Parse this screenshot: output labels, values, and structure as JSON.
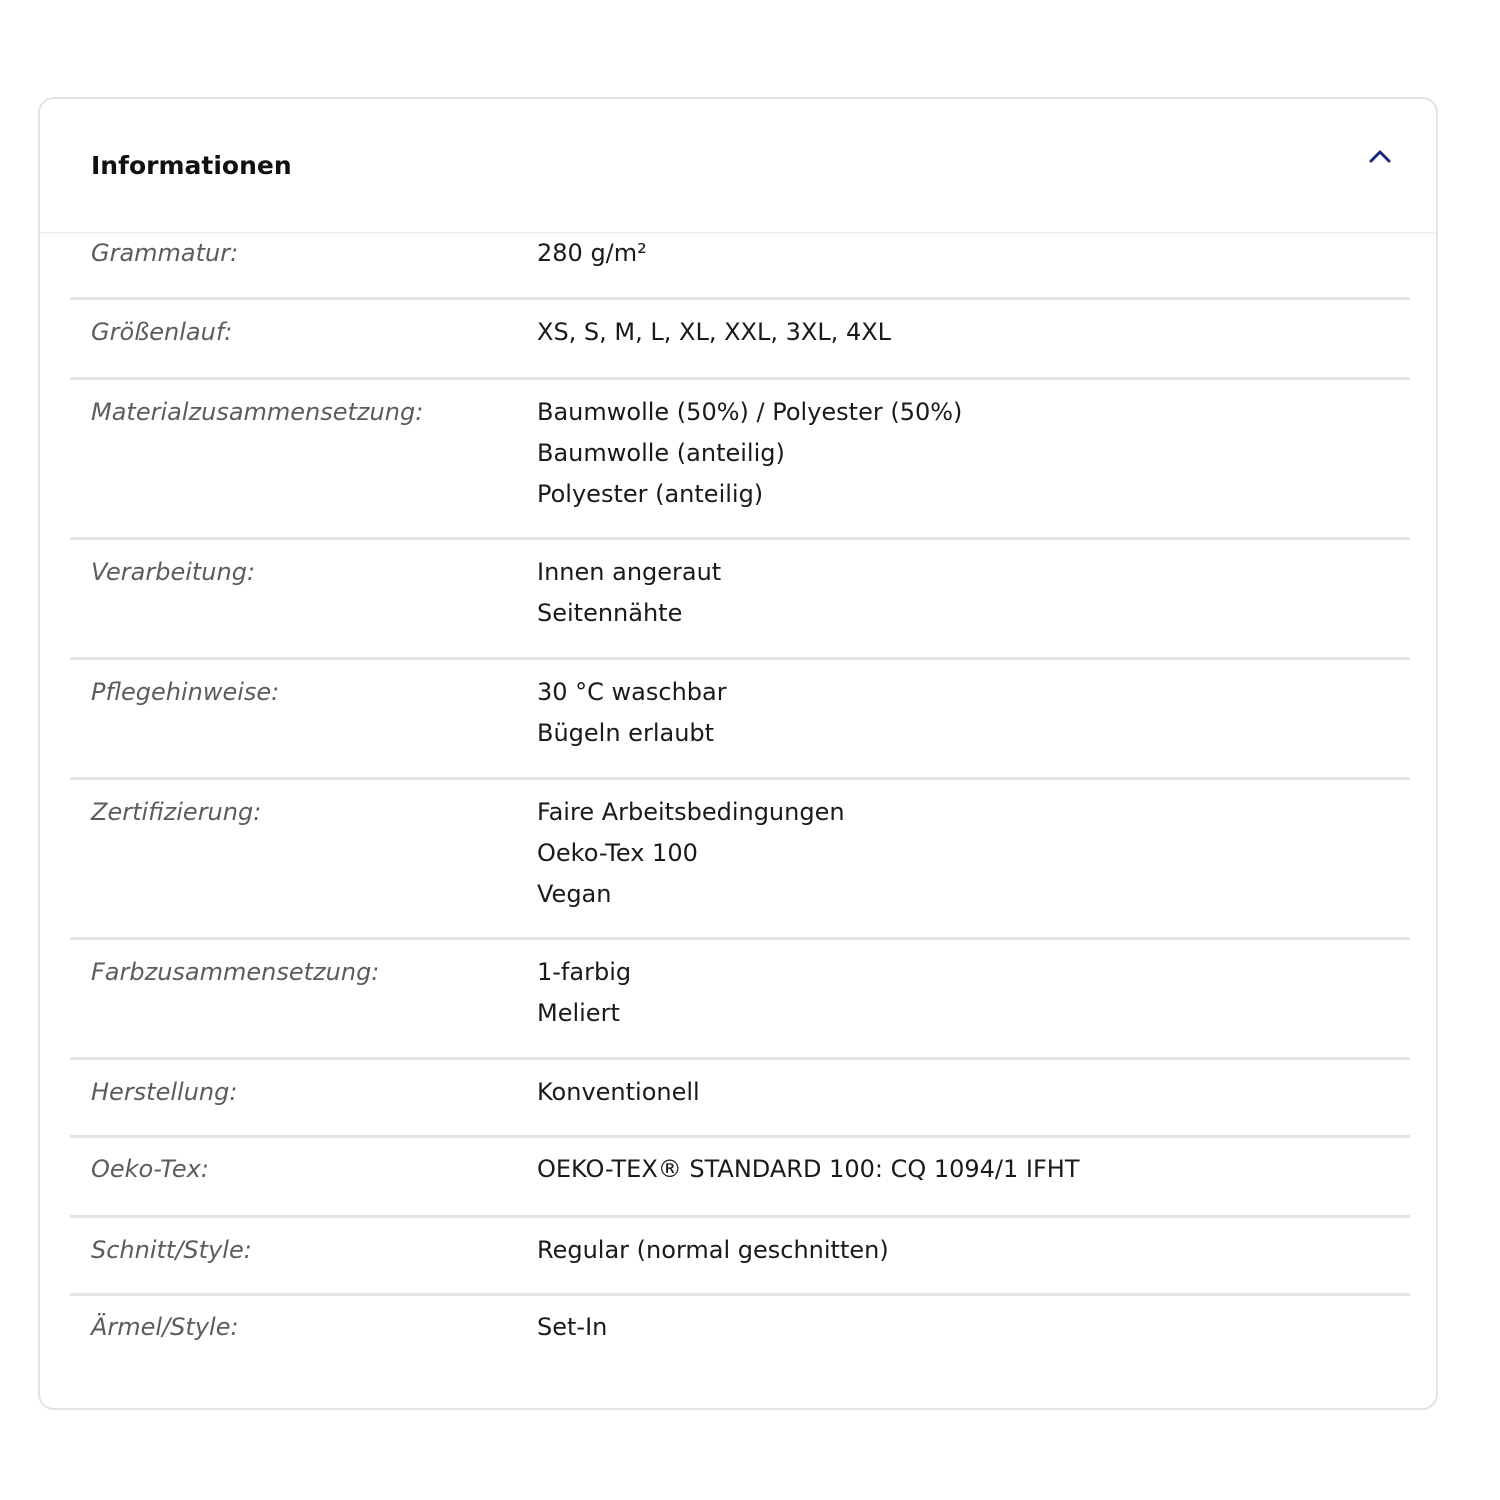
{
  "accordion": {
    "title": "Informationen",
    "toggle_icon": "chevron-up-icon",
    "accent_color": "#1a2a7a",
    "expanded": true
  },
  "rows": [
    {
      "label": "Grammatur:",
      "values": [
        "280 g/m²"
      ]
    },
    {
      "label": "Größenlauf:",
      "values": [
        "XS, S, M, L, XL, XXL, 3XL, 4XL"
      ]
    },
    {
      "label": "Materialzusammensetzung:",
      "values": [
        "Baumwolle (50%) / Polyester (50%)",
        "Baumwolle (anteilig)",
        "Polyester (anteilig)"
      ]
    },
    {
      "label": "Verarbeitung:",
      "values": [
        "Innen angeraut",
        "Seitennähte"
      ]
    },
    {
      "label": "Pflegehinweise:",
      "values": [
        "30 °C waschbar",
        "Bügeln erlaubt"
      ]
    },
    {
      "label": "Zertifizierung:",
      "values": [
        "Faire Arbeitsbedingungen",
        "Oeko-Tex 100",
        "Vegan"
      ]
    },
    {
      "label": "Farbzusammensetzung:",
      "values": [
        "1-farbig",
        "Meliert"
      ]
    },
    {
      "label": "Herstellung:",
      "values": [
        "Konventionell"
      ]
    },
    {
      "label": "Oeko-Tex:",
      "values": [
        "OEKO-TEX® STANDARD 100: CQ 1094/1 IFHT"
      ]
    },
    {
      "label": "Schnitt/Style:",
      "values": [
        "Regular (normal geschnitten)"
      ]
    },
    {
      "label": "Ärmel/Style:",
      "values": [
        "Set-In"
      ]
    }
  ]
}
